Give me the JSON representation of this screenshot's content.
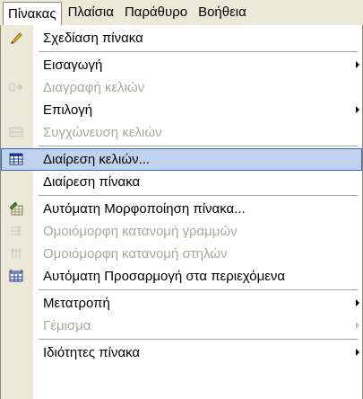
{
  "menubar": {
    "items": [
      {
        "label": "Πίνακας",
        "ul": "ν"
      },
      {
        "label": "Πλαίσια",
        "ul": "ι"
      },
      {
        "label": "Παράθυρο",
        "ul": "Π"
      },
      {
        "label": "Βοήθεια",
        "ul": "Β"
      }
    ]
  },
  "menu": {
    "items": [
      {
        "label": "Σχεδίαση πίνακα",
        "icon": "pencil-icon",
        "enabled": true
      },
      {
        "label": "Εισαγωγή",
        "icon": "",
        "enabled": true,
        "submenu": true
      },
      {
        "label": "Διαγραφή κελιών",
        "icon": "delete-cells-icon",
        "enabled": false
      },
      {
        "label": "Επιλογή",
        "icon": "",
        "enabled": true,
        "submenu": true
      },
      {
        "label": "Συγχώνευση κελιών",
        "icon": "merge-cells-icon",
        "enabled": false
      },
      {
        "label": "Διαίρεση κελιών...",
        "icon": "split-cells-icon",
        "enabled": true,
        "highlighted": true
      },
      {
        "label": "Διαίρεση πίνακα",
        "icon": "",
        "enabled": true
      },
      {
        "label": "Αυτόματη Μορφοποίηση πίνακα...",
        "icon": "autoformat-icon",
        "enabled": true
      },
      {
        "label": "Ομοιόμορφη κατανομή γραμμών",
        "icon": "distribute-rows-icon",
        "enabled": false
      },
      {
        "label": "Ομοιόμορφη κατανομή στηλών",
        "icon": "distribute-columns-icon",
        "enabled": false
      },
      {
        "label": "Αυτόματη Προσαρμογή στα περιεχόμενα",
        "icon": "autofit-icon",
        "enabled": true
      },
      {
        "label": "Μετατροπή",
        "icon": "",
        "enabled": true,
        "submenu": true
      },
      {
        "label": "Γέμισμα",
        "icon": "",
        "enabled": false,
        "submenu": true
      },
      {
        "label": "Ιδιότητες πίνακα",
        "icon": "",
        "enabled": true,
        "submenu": true
      }
    ]
  },
  "colors": {
    "highlight": "#c1d2ee",
    "highlight_border": "#316ac5",
    "disabled_text": "#aca899",
    "menubar_bg": "#ece9d8"
  }
}
